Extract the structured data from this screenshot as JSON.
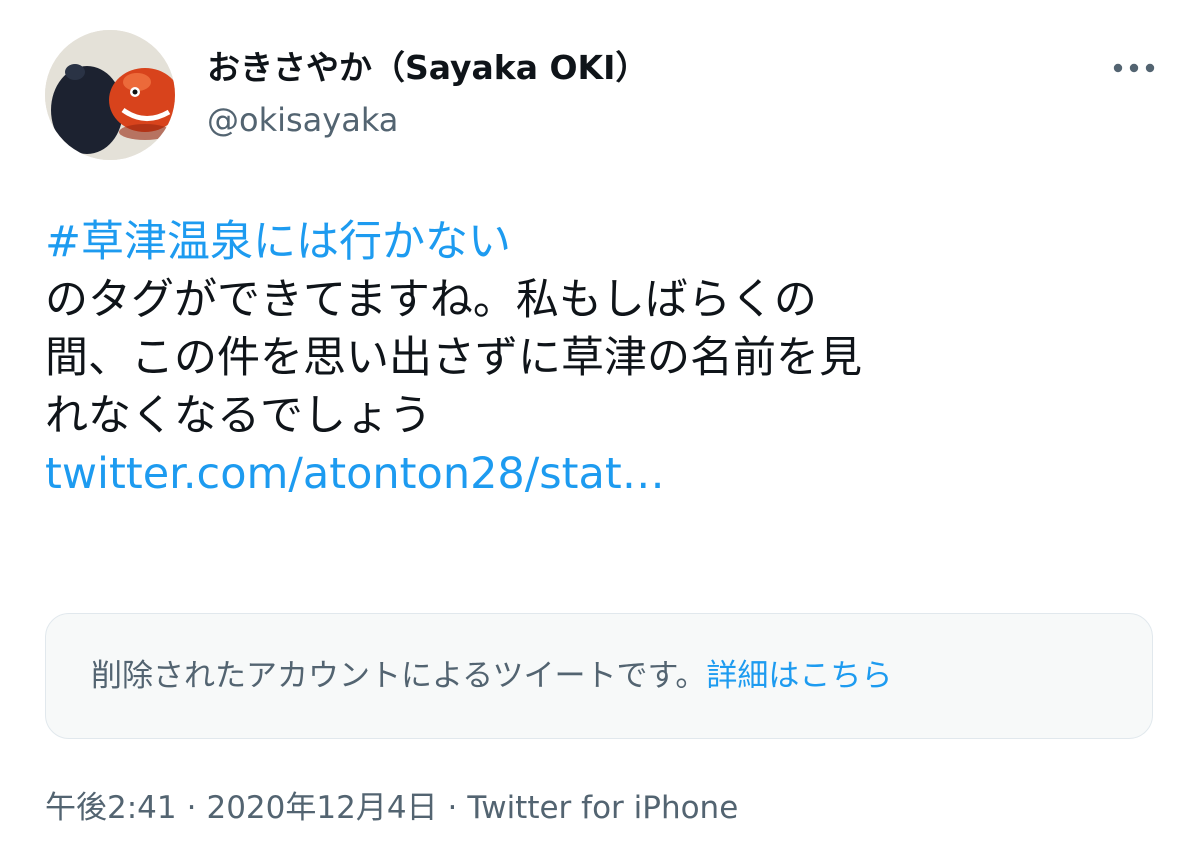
{
  "author": {
    "display_name": "おきさやか（Sayaka OKI）",
    "handle": "@okisayaka",
    "avatar_icon": "avatar-photo"
  },
  "menu": {
    "icon": "more-horizontal-icon"
  },
  "tweet": {
    "hashtag": "#草津温泉には行かない",
    "lines": [
      "のタグができてますね。私もしばらくの",
      "間、この件を思い出さずに草津の名前を見",
      "れなくなるでしょう"
    ],
    "link": "twitter.com/atonton28/stat…"
  },
  "notice": {
    "text": "削除されたアカウントによるツイートです。",
    "link": "詳細はこちら"
  },
  "meta": {
    "time": "午後2:41",
    "separator": "·",
    "date": "2020年12月4日",
    "source": "Twitter for iPhone"
  },
  "colors": {
    "link": "#1d9bf0",
    "secondary_text": "#536471",
    "primary_text": "#0f1419",
    "card_background": "#f7f9f9",
    "card_border": "#e1e8ed"
  }
}
